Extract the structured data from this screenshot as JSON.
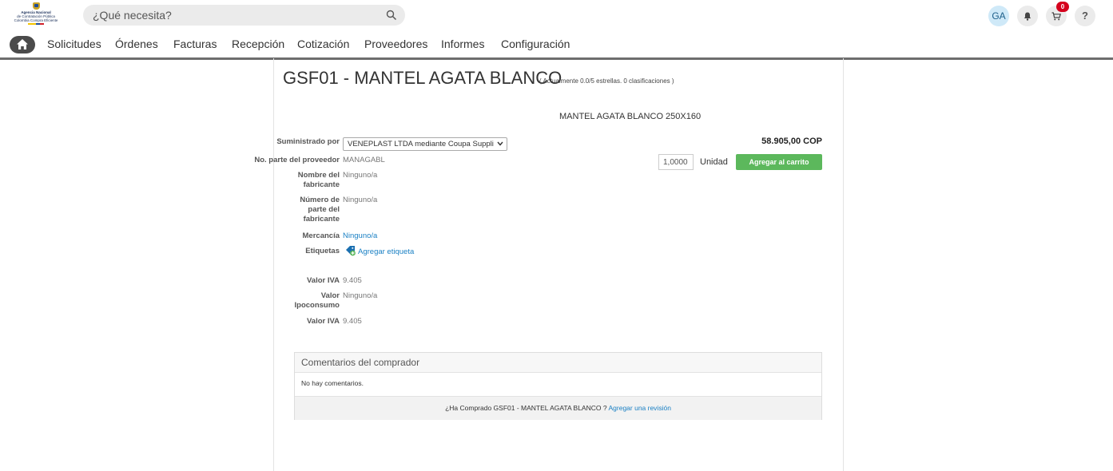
{
  "logo": {
    "line1": "Agencia Nacional",
    "line2": "de Contratación Pública",
    "line3": "Colombia Compra Eficiente"
  },
  "search": {
    "placeholder": "¿Qué necesita?"
  },
  "header": {
    "avatar_initials": "GA",
    "cart_count": "0",
    "help_label": "?"
  },
  "nav": {
    "items": [
      "Solicitudes",
      "Órdenes",
      "Facturas",
      "Recepción",
      "Cotización",
      "Proveedores",
      "Informes",
      "Configuración"
    ]
  },
  "product": {
    "title": "GSF01 - MANTEL AGATA BLANCO",
    "rating_text": "( Actualmente 0.0/5 estrellas. 0 clasificaciones )",
    "description": "MANTEL AGATA BLANCO 250X160",
    "price": "58.905,00 COP",
    "quantity": "1,0000",
    "unit": "Unidad",
    "add_to_cart_label": "Agregar al carrito"
  },
  "details": {
    "supplied_by_label": "Suministrado por",
    "supplied_by_value": "VENEPLAST LTDA mediante Coupa Suppli",
    "supplier_part_label": "No. parte del proveedor",
    "supplier_part_value": "MANAGABL",
    "manufacturer_name_label_1": "Nombre del",
    "manufacturer_name_label_2": "fabricante",
    "manufacturer_name_value": "Ninguno/a",
    "manufacturer_part_label_1": "Número de",
    "manufacturer_part_label_2": "parte del",
    "manufacturer_part_label_3": "fabricante",
    "manufacturer_part_value": "Ninguno/a",
    "commodity_label": "Mercancía",
    "commodity_value": "Ninguno/a",
    "tags_label": "Etiquetas",
    "add_tag_label": "Agregar etiqueta",
    "iva_label": "Valor IVA",
    "iva_value": "9.405",
    "ipoconsumo_label_1": "Valor",
    "ipoconsumo_label_2": "Ipoconsumo",
    "ipoconsumo_value": "Ninguno/a",
    "iva2_label": "Valor IVA",
    "iva2_value": "9.405"
  },
  "comments": {
    "header": "Comentarios del comprador",
    "empty_text": "No hay comentarios.",
    "footer_question": "¿Ha Comprado GSF01 - MANTEL AGATA BLANCO ?",
    "footer_link": "Agregar una revisión"
  },
  "colors": {
    "accent_green": "#5cb85c",
    "link_blue": "#1a80c4",
    "badge_red": "#d5001c"
  }
}
